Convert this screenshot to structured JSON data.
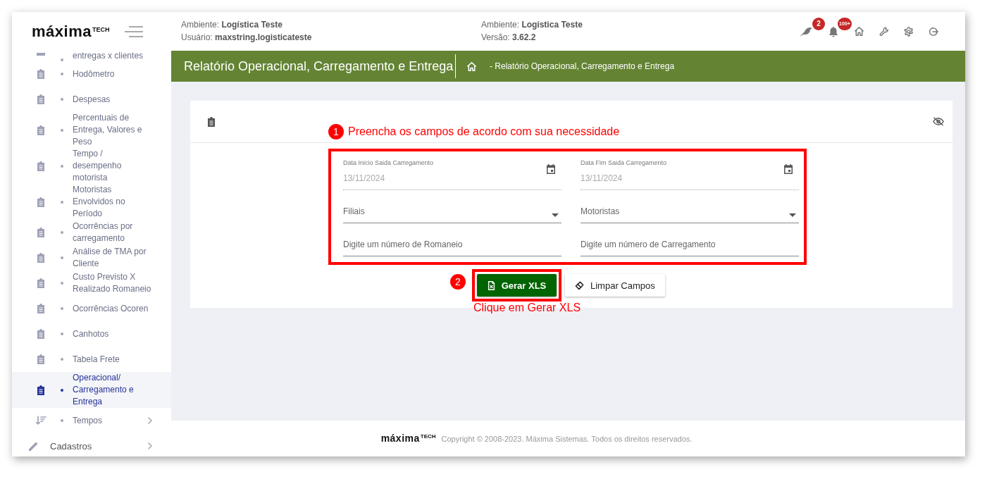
{
  "logo": {
    "name": "máxima",
    "suffix": "TECH"
  },
  "header": {
    "info": [
      "Ambiente: **Logística Teste**",
      "Usuário: **maxstring.logisticateste**",
      "Ambiente: **Logística Teste**",
      "Versão: **3.62.2**"
    ],
    "actions": [
      {
        "kind": "bird",
        "badge": "2"
      },
      {
        "kind": "bell",
        "badge": "100+"
      },
      {
        "kind": "home"
      },
      {
        "kind": "wrench"
      },
      {
        "kind": "settings"
      },
      {
        "kind": "logout"
      }
    ]
  },
  "sidebar": {
    "items": [
      {
        "kind": "cut",
        "label": "entregas x clientes",
        "selected": false
      },
      {
        "kind": "report",
        "label": "Hodômetro",
        "selected": false
      },
      {
        "kind": "report",
        "label": "Despesas",
        "selected": false
      },
      {
        "kind": "report",
        "label": "Percentuais de Entrega, Valores e Peso",
        "selected": false
      },
      {
        "kind": "report",
        "label": "Tempo / desempenho motorista",
        "selected": false
      },
      {
        "kind": "report",
        "label": "Motoristas Envolvidos no Período",
        "selected": false
      },
      {
        "kind": "report",
        "label": "Ocorrências por carregamento",
        "selected": false
      },
      {
        "kind": "report",
        "label": "Análise de TMA por Cliente",
        "selected": false
      },
      {
        "kind": "report",
        "label": "Custo Previsto X Realizado Romaneio",
        "selected": false
      },
      {
        "kind": "report",
        "label": "Ocorrências Ocoren",
        "selected": false
      },
      {
        "kind": "report",
        "label": "Canhotos",
        "selected": false
      },
      {
        "kind": "report",
        "label": "Tabela Frete",
        "selected": false
      },
      {
        "kind": "report",
        "label": "Operacional/ Carregamento e Entrega",
        "selected": true
      },
      {
        "kind": "group",
        "label": "Tempos",
        "selected": false,
        "expanded": false
      },
      {
        "kind": "section",
        "label": "Cadastros",
        "selected": false,
        "expanded": false
      }
    ]
  },
  "page_bar": {
    "title": "Relatório Operacional, Carregamento e Entrega",
    "breadcrumb": "- Relatório Operacional, Carregamento e Entrega"
  },
  "form": {
    "fields": [
      {
        "kind": "date",
        "label": "Data Inicio Saida Carregamento",
        "value": "13/11/2024"
      },
      {
        "kind": "date",
        "label": "Data Fim Saida Carregamento",
        "value": "13/11/2024"
      },
      {
        "kind": "select",
        "placeholder": "Filiais"
      },
      {
        "kind": "select",
        "placeholder": "Motoristas"
      },
      {
        "kind": "text",
        "placeholder": "Digite um número de Romaneio"
      },
      {
        "kind": "text",
        "placeholder": "Digite um número de Carregamento"
      }
    ],
    "buttons": [
      {
        "kind": "primary",
        "label": "Gerar XLS"
      },
      {
        "kind": "secondary",
        "label": "Limpar Campos"
      }
    ]
  },
  "annotations": [
    {
      "number": "1",
      "text": "Preencha os campos de acordo com sua necessidade"
    },
    {
      "number": "2",
      "text": "Clique em Gerar XLS"
    }
  ],
  "footer": {
    "logo": {
      "name": "máxima",
      "suffix": "TECH"
    },
    "copyright": "Copyright © 2008-2023. Máxima Sistemas. Todos os direitos reservados."
  }
}
